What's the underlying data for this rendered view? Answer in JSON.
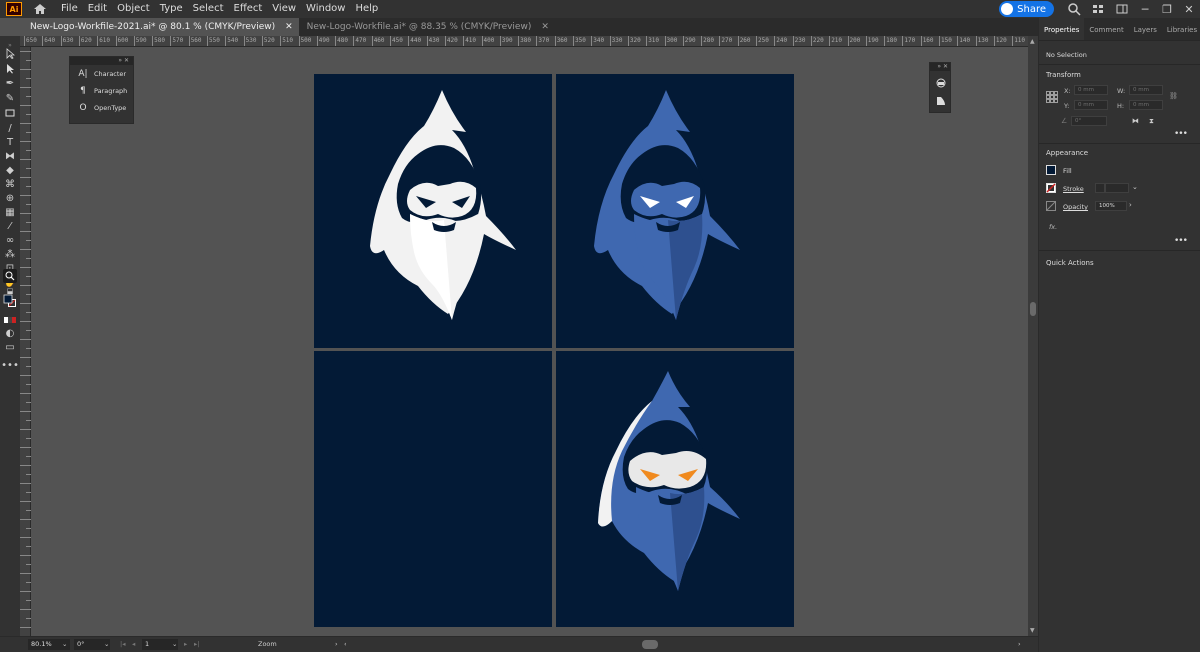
{
  "app": {
    "logo_text": "Ai"
  },
  "menu": [
    "File",
    "Edit",
    "Object",
    "Type",
    "Select",
    "Effect",
    "View",
    "Window",
    "Help"
  ],
  "share_label": "Share",
  "tabs": [
    {
      "label": "New-Logo-Workfile-2021.ai* @ 80.1 % (CMYK/Preview)",
      "active": true
    },
    {
      "label": "New-Logo-Workfile.ai* @ 88.35 % (CMYK/Preview)",
      "active": false
    }
  ],
  "ruler_labels": [
    "650",
    "640",
    "630",
    "620",
    "610",
    "600",
    "590",
    "580",
    "570",
    "560",
    "550",
    "540",
    "530",
    "520",
    "510",
    "500",
    "490",
    "480",
    "470",
    "460",
    "450",
    "440",
    "430",
    "420",
    "410",
    "400",
    "390",
    "380",
    "370",
    "360",
    "350",
    "340",
    "330",
    "320",
    "310",
    "300",
    "290",
    "280",
    "270",
    "260",
    "250",
    "240",
    "230",
    "220",
    "210",
    "200",
    "190",
    "180",
    "170",
    "160",
    "150",
    "140",
    "130",
    "120",
    "110"
  ],
  "type_panel": {
    "items": [
      {
        "icon": "A|",
        "label": "Character"
      },
      {
        "icon": "¶",
        "label": "Paragraph"
      },
      {
        "icon": "O",
        "label": "OpenType"
      }
    ]
  },
  "right_panel": {
    "tabs": [
      "Properties",
      "Comment",
      "Layers",
      "Libraries"
    ],
    "selection": "No Selection",
    "transform_title": "Transform",
    "x_label": "X:",
    "y_label": "Y:",
    "w_label": "W:",
    "h_label": "H:",
    "x_value": "0 mm",
    "y_value": "0 mm",
    "w_value": "0 mm",
    "h_value": "0 mm",
    "angle_value": "0°",
    "appearance_title": "Appearance",
    "fill_label": "Fill",
    "stroke_label": "Stroke",
    "opacity_label": "Opacity",
    "opacity_value": "100%",
    "fx_label": "fx.",
    "quick_actions_title": "Quick Actions",
    "colors": {
      "fill": "#031a36",
      "stroke": "#cc2222"
    }
  },
  "status": {
    "zoom": "80.1%",
    "rotation": "0°",
    "artboard": "1",
    "tool": "Zoom"
  },
  "colors": {
    "artboard_bg": "#031a36",
    "logo_white": "#f2f2f2",
    "logo_blue": "#3f68b0",
    "logo_blue_dark": "#2e508f",
    "eye_orange": "#f08a1e",
    "accent": "#1473e6"
  }
}
